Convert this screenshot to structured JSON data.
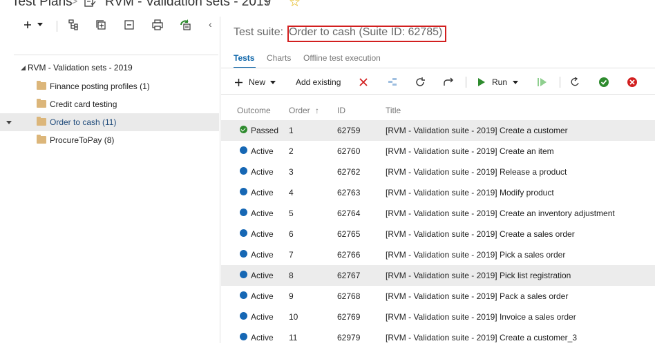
{
  "breadcrumb": {
    "root": "Test Plans",
    "separator": ">",
    "plan": "RVM - Validation sets - 2019",
    "dropdown": "∨",
    "star": "☆"
  },
  "left_toolbar": {
    "icons": [
      "add-icon",
      "chevron-down-icon",
      "new-suite-icon",
      "expand-all-icon",
      "collapse-all-icon",
      "print-icon",
      "refresh-icon"
    ],
    "collapse_pane": "‹"
  },
  "tree": {
    "root": "RVM - Validation sets - 2019",
    "items": [
      {
        "label": "Finance posting profiles (1)"
      },
      {
        "label": "Credit card testing"
      },
      {
        "label": "Order to cash (11)"
      },
      {
        "label": "ProcureToPay (8)"
      }
    ],
    "selected_index": 2
  },
  "suite": {
    "prefix": "Test suite:",
    "name": "Order to cash (Suite ID: 62785)"
  },
  "tabs": [
    {
      "label": "Tests"
    },
    {
      "label": "Charts"
    },
    {
      "label": "Offline test execution"
    }
  ],
  "toolbar": {
    "new_label": "New",
    "add_existing_label": "Add existing",
    "run_label": "Run"
  },
  "columns": {
    "outcome": "Outcome",
    "order": "Order",
    "id": "ID",
    "title": "Title"
  },
  "rows": [
    {
      "outcome": "Passed",
      "order": "1",
      "id": "62759",
      "title": "[RVM - Validation suite - 2019] Create a customer"
    },
    {
      "outcome": "Active",
      "order": "2",
      "id": "62760",
      "title": "[RVM - Validation suite - 2019] Create an item"
    },
    {
      "outcome": "Active",
      "order": "3",
      "id": "62762",
      "title": "[RVM - Validation suite - 2019] Release a product"
    },
    {
      "outcome": "Active",
      "order": "4",
      "id": "62763",
      "title": "[RVM - Validation suite - 2019] Modify product"
    },
    {
      "outcome": "Active",
      "order": "5",
      "id": "62764",
      "title": "[RVM - Validation suite - 2019] Create an inventory adjustment"
    },
    {
      "outcome": "Active",
      "order": "6",
      "id": "62765",
      "title": "[RVM - Validation suite - 2019] Create a sales order"
    },
    {
      "outcome": "Active",
      "order": "7",
      "id": "62766",
      "title": "[RVM - Validation suite - 2019] Pick a sales order"
    },
    {
      "outcome": "Active",
      "order": "8",
      "id": "62767",
      "title": "[RVM - Validation suite - 2019] Pick list registration"
    },
    {
      "outcome": "Active",
      "order": "9",
      "id": "62768",
      "title": "[RVM - Validation suite - 2019] Pack a sales order"
    },
    {
      "outcome": "Active",
      "order": "10",
      "id": "62769",
      "title": "[RVM - Validation suite - 2019] Invoice a sales order"
    },
    {
      "outcome": "Active",
      "order": "11",
      "id": "62979",
      "title": "[RVM - Validation suite - 2019] Create a customer_3"
    }
  ],
  "colors": {
    "accent": "#0a63a8",
    "active_dot": "#1667b4",
    "passed": "#2e8b2e",
    "delete_red": "#d21f1f",
    "highlight_box": "#d21f1f"
  }
}
